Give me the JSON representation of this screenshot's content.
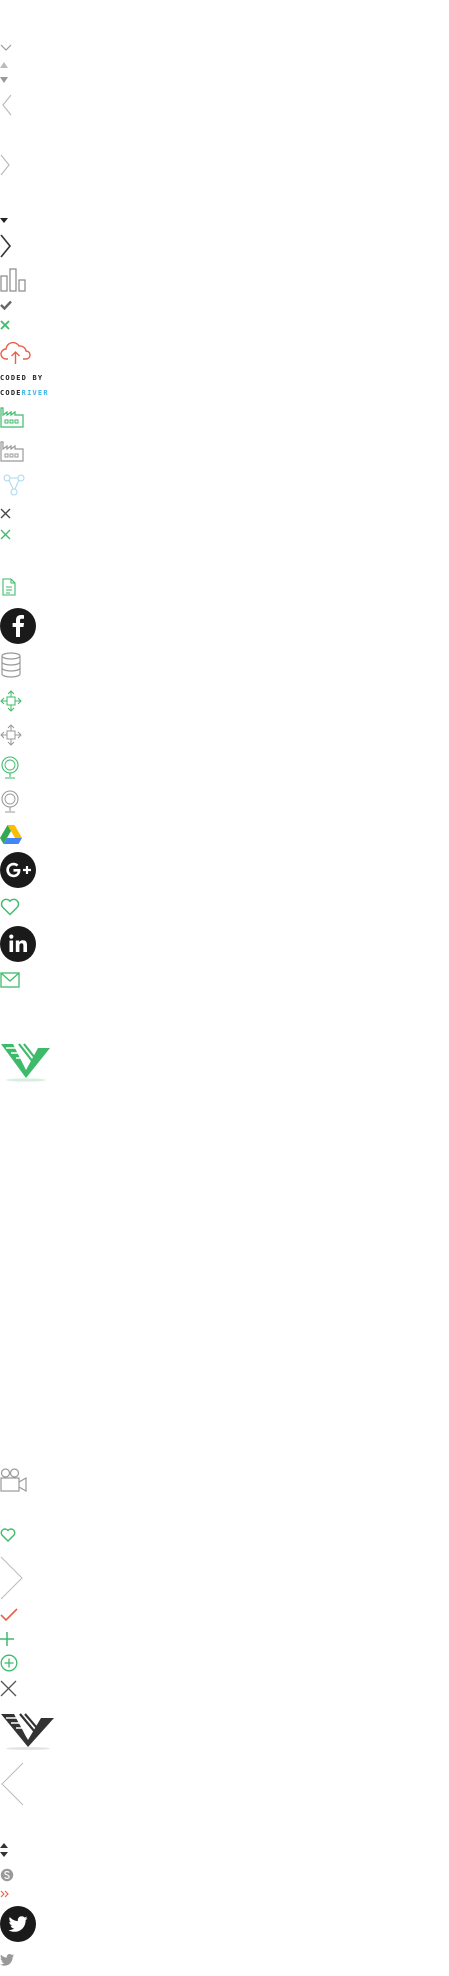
{
  "sprites": [
    {
      "name": "chevron-down-icon",
      "color": "#9a9a9a"
    },
    {
      "name": "arrow-up-icon",
      "color": "#9a9a9a"
    },
    {
      "name": "arrow-down-icon",
      "color": "#9a9a9a"
    },
    {
      "name": "chevron-left-icon",
      "color": "#bbbbbb"
    },
    {
      "name": "chevron-right-icon",
      "color": "#bbbbbb"
    },
    {
      "name": "caret-down-icon",
      "color": "#222222"
    },
    {
      "name": "chevron-right-dark-icon",
      "color": "#333333"
    },
    {
      "name": "bar-chart-icon",
      "color": "#888888"
    },
    {
      "name": "checkmark-icon",
      "color": "#666666"
    },
    {
      "name": "close-green-icon",
      "color": "#3dbb6a"
    },
    {
      "name": "cloud-upload-icon",
      "color": "#e8604a"
    },
    {
      "name": "factory-green-icon",
      "color": "#3dbb6a"
    },
    {
      "name": "factory-gray-icon",
      "color": "#999999"
    },
    {
      "name": "network-icon",
      "color": "#a8d8f0"
    },
    {
      "name": "close-dark-icon",
      "color": "#444444"
    },
    {
      "name": "close-green-small-icon",
      "color": "#3dbb6a"
    },
    {
      "name": "document-icon",
      "color": "#3dbb6a"
    },
    {
      "name": "facebook-icon",
      "color": "#1a1a1a"
    },
    {
      "name": "coins-icon",
      "color": "#999999"
    },
    {
      "name": "expand-green-icon",
      "color": "#3dbb6a"
    },
    {
      "name": "expand-gray-icon",
      "color": "#999999"
    },
    {
      "name": "globe-green-icon",
      "color": "#3dbb6a"
    },
    {
      "name": "globe-gray-icon",
      "color": "#999999"
    },
    {
      "name": "google-drive-icon",
      "color": "#4285f4"
    },
    {
      "name": "google-plus-icon",
      "color": "#1a1a1a"
    },
    {
      "name": "heart-icon",
      "color": "#3dbb6a"
    },
    {
      "name": "linkedin-icon",
      "color": "#1a1a1a"
    },
    {
      "name": "mail-icon",
      "color": "#3dbb6a"
    },
    {
      "name": "logo-green-icon",
      "color": "#3dbb6a"
    },
    {
      "name": "video-camera-icon",
      "color": "#999999"
    },
    {
      "name": "heart-small-icon",
      "color": "#3dbb6a"
    },
    {
      "name": "chevron-right-large-icon",
      "color": "#bbbbbb"
    },
    {
      "name": "check-red-icon",
      "color": "#e8604a"
    },
    {
      "name": "plus-green-icon",
      "color": "#3dbb6a"
    },
    {
      "name": "plus-circle-icon",
      "color": "#3dbb6a"
    },
    {
      "name": "close-large-icon",
      "color": "#555555"
    },
    {
      "name": "logo-dark-icon",
      "color": "#333333"
    },
    {
      "name": "chevron-left-large-icon",
      "color": "#bbbbbb"
    },
    {
      "name": "sort-arrows-icon",
      "color": "#333333"
    },
    {
      "name": "skype-icon",
      "color": "#999999"
    },
    {
      "name": "double-chevron-icon",
      "color": "#e8604a"
    },
    {
      "name": "twitter-circle-icon",
      "color": "#1a1a1a"
    },
    {
      "name": "twitter-small-icon",
      "color": "#999999"
    }
  ],
  "credit": {
    "coded_by": "CODED BY",
    "brand_code": "CODE",
    "brand_river": "RIVER",
    "brand_code_color": "#222222",
    "brand_river_color": "#3ab4e8"
  }
}
